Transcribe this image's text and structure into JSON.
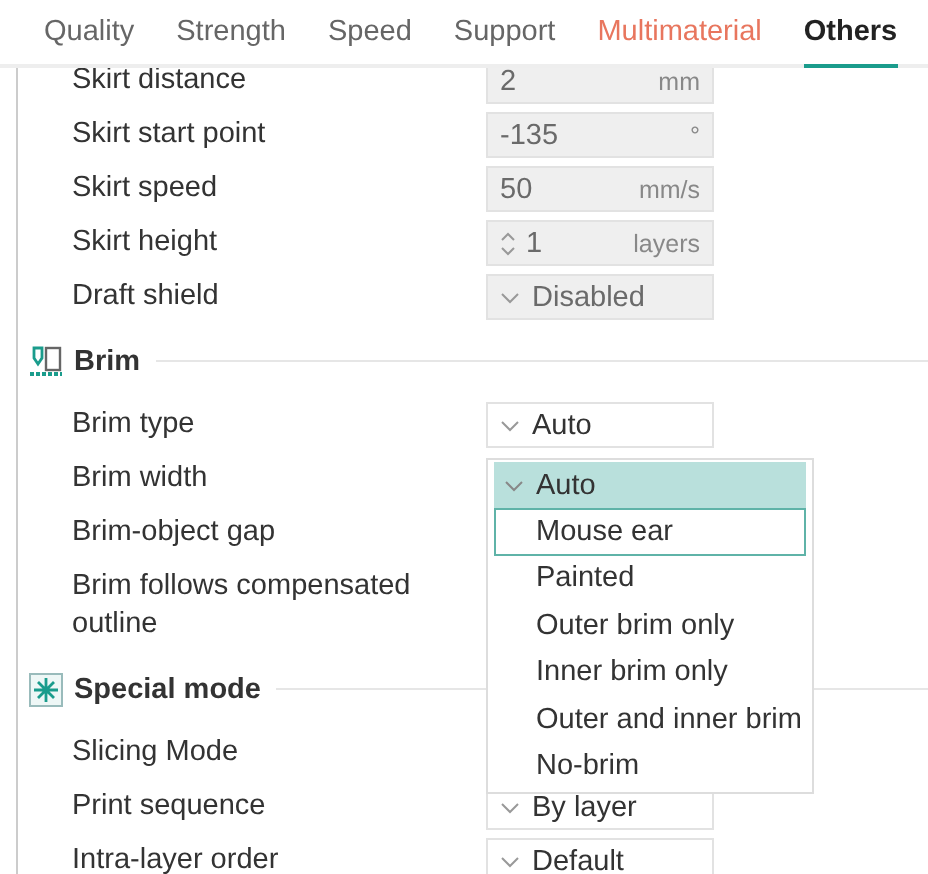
{
  "tabs": [
    {
      "label": "Quality",
      "selected": false,
      "modified": false
    },
    {
      "label": "Strength",
      "selected": false,
      "modified": false
    },
    {
      "label": "Speed",
      "selected": false,
      "modified": false
    },
    {
      "label": "Support",
      "selected": false,
      "modified": false
    },
    {
      "label": "Multimaterial",
      "selected": false,
      "modified": true
    },
    {
      "label": "Others",
      "selected": true,
      "modified": false
    }
  ],
  "sections": [
    {
      "rows": [
        {
          "label": "Skirt distance",
          "field": {
            "kind": "number",
            "value": "2",
            "unit": "mm",
            "disabled": true
          }
        },
        {
          "label": "Skirt start point",
          "field": {
            "kind": "number",
            "value": "-135",
            "unit": "°",
            "disabled": true
          }
        },
        {
          "label": "Skirt speed",
          "field": {
            "kind": "number",
            "value": "50",
            "unit": "mm/s",
            "disabled": true
          }
        },
        {
          "label": "Skirt height",
          "field": {
            "kind": "spin",
            "value": "1",
            "unit": "layers",
            "disabled": true
          }
        },
        {
          "label": "Draft shield",
          "field": {
            "kind": "select",
            "value": "Disabled",
            "disabled": true
          }
        }
      ]
    },
    {
      "title": "Brim",
      "rows": [
        {
          "label": "Brim type",
          "field": {
            "kind": "select",
            "value": "Auto",
            "disabled": false
          }
        },
        {
          "label": "Brim width"
        },
        {
          "label": "Brim-object gap"
        },
        {
          "label": "Brim follows compensated outline"
        }
      ]
    },
    {
      "title": "Special mode",
      "rows": [
        {
          "label": "Slicing Mode"
        },
        {
          "label": "Print sequence",
          "field": {
            "kind": "select",
            "value": "By layer",
            "disabled": false
          }
        },
        {
          "label": "Intra-layer order",
          "field": {
            "kind": "select",
            "value": "Default",
            "disabled": false
          }
        }
      ]
    }
  ],
  "dropdown": {
    "items": [
      {
        "label": "Auto",
        "selected": true,
        "focused": false
      },
      {
        "label": "Mouse ear",
        "selected": false,
        "focused": true
      },
      {
        "label": "Painted",
        "selected": false,
        "focused": false
      },
      {
        "label": "Outer brim only",
        "selected": false,
        "focused": false
      },
      {
        "label": "Inner brim only",
        "selected": false,
        "focused": false
      },
      {
        "label": "Outer and inner brim",
        "selected": false,
        "focused": false
      },
      {
        "label": "No-brim",
        "selected": false,
        "focused": false
      }
    ]
  }
}
